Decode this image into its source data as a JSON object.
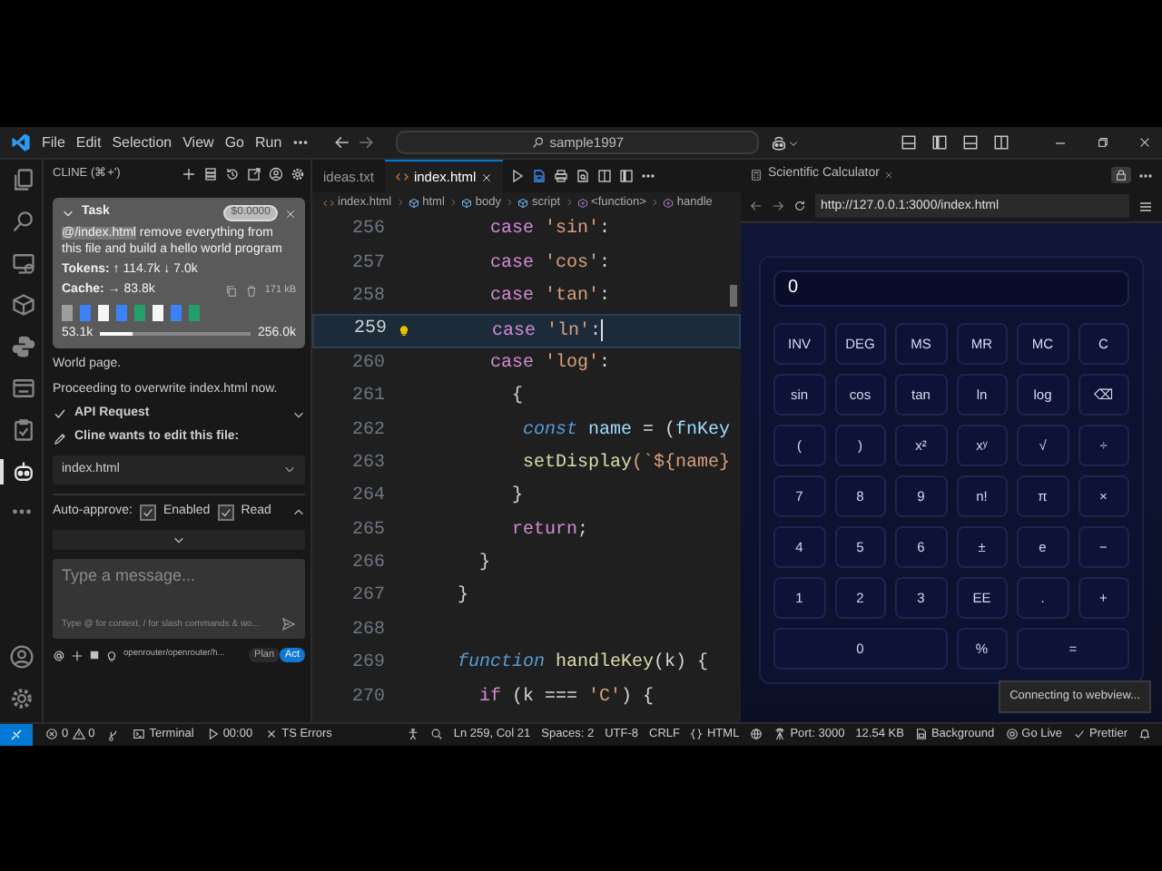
{
  "title_bar": {
    "menu": [
      "File",
      "Edit",
      "Selection",
      "View",
      "Go",
      "Run"
    ],
    "search": "sample1997"
  },
  "activity_bar": {
    "items": [
      {
        "kind": "files",
        "selected": false
      },
      {
        "kind": "search",
        "selected": false
      },
      {
        "kind": "remote",
        "selected": false
      },
      {
        "kind": "extensions",
        "selected": false
      },
      {
        "kind": "python",
        "selected": false
      },
      {
        "kind": "panel",
        "selected": false
      },
      {
        "kind": "tasks",
        "selected": false
      },
      {
        "kind": "robot",
        "selected": true
      }
    ]
  },
  "cline": {
    "header": "CLINE (⌘+')",
    "task": {
      "title": "Task",
      "expanded": true,
      "cost": "$0.0000",
      "mention": "@/index.html",
      "text": "remove everything from this file and build a hello world program",
      "tokens": "**Tokens:** ↑ 114.7k ↓ 7.0k",
      "cache": "**Cache:** → 83.8k",
      "size": "171 kB",
      "segments": [
        {
          "color": "#9e9e9e"
        },
        {
          "color": "#3b82f6"
        },
        {
          "color": "#f5f5f5"
        },
        {
          "color": "#3b82f6"
        },
        {
          "color": "#22a06b"
        },
        {
          "color": "#f5f5f5"
        },
        {
          "color": "#3b82f6"
        },
        {
          "color": "#22a06b"
        }
      ],
      "context": {
        "used": "53.1k",
        "level": 0.22,
        "max": "256.0k"
      }
    },
    "messages": [
      "World page.",
      "Proceeding to overwrite index.html now."
    ],
    "api_request": {
      "title": "API Request",
      "done": true,
      "expanded": false
    },
    "edit_request": {
      "title": "Cline wants to edit this file:",
      "file": "index.html"
    },
    "auto_approve": {
      "label": "Auto-approve:",
      "options": [
        {
          "label": "Enabled",
          "checked": true
        },
        {
          "label": "Read",
          "checked": true
        }
      ]
    },
    "input": {
      "placeholder": "Type a message...",
      "hint": "Type @ for context, / for slash commands & wo..."
    },
    "model": "openrouter/openrouter/h...",
    "modes": [
      {
        "label": "Plan",
        "selected": false
      },
      {
        "label": "Act",
        "selected": true
      }
    ]
  },
  "editor": {
    "tabs": [
      {
        "label": "ideas.txt",
        "selected": false
      },
      {
        "label": "index.html",
        "selected": true
      }
    ],
    "breadcrumb": [
      {
        "label": "index.html",
        "kind": "file"
      },
      {
        "label": "html",
        "kind": "element"
      },
      {
        "label": "body",
        "kind": "element"
      },
      {
        "label": "script",
        "kind": "element"
      },
      {
        "label": "<function>",
        "kind": "function"
      },
      {
        "label": "handle",
        "kind": "function"
      }
    ],
    "lines": [
      {
        "number": "256",
        "current": false,
        "tokens": [
          {
            "text": "       case",
            "kind": "keyword"
          },
          {
            "text": " 'sin'",
            "kind": "string"
          },
          {
            "text": ":",
            "kind": "plain"
          }
        ]
      },
      {
        "number": "257",
        "current": false,
        "tokens": [
          {
            "text": "       case",
            "kind": "keyword"
          },
          {
            "text": " 'cos'",
            "kind": "string"
          },
          {
            "text": ":",
            "kind": "plain"
          }
        ]
      },
      {
        "number": "258",
        "current": false,
        "tokens": [
          {
            "text": "       case",
            "kind": "keyword"
          },
          {
            "text": " 'tan'",
            "kind": "string"
          },
          {
            "text": ":",
            "kind": "plain"
          }
        ]
      },
      {
        "number": "259",
        "current": true,
        "tokens": [
          {
            "text": "       case",
            "kind": "keyword"
          },
          {
            "text": " 'ln'",
            "kind": "string"
          },
          {
            "text": ":",
            "kind": "plain"
          }
        ]
      },
      {
        "number": "260",
        "current": false,
        "tokens": [
          {
            "text": "       case",
            "kind": "keyword"
          },
          {
            "text": " 'log'",
            "kind": "string"
          },
          {
            "text": ":",
            "kind": "plain"
          }
        ]
      },
      {
        "number": "261",
        "current": false,
        "tokens": [
          {
            "text": "         {",
            "kind": "plain"
          }
        ]
      },
      {
        "number": "262",
        "current": false,
        "tokens": [
          {
            "text": "          const",
            "kind": "declare"
          },
          {
            "text": " name",
            "kind": "variable"
          },
          {
            "text": " = (",
            "kind": "plain"
          },
          {
            "text": "fnKey",
            "kind": "variable"
          }
        ]
      },
      {
        "number": "263",
        "current": false,
        "tokens": [
          {
            "text": "          setDisplay",
            "kind": "function"
          },
          {
            "text": "(`${name}",
            "kind": "string"
          }
        ]
      },
      {
        "number": "264",
        "current": false,
        "tokens": [
          {
            "text": "         }",
            "kind": "plain"
          }
        ]
      },
      {
        "number": "265",
        "current": false,
        "tokens": [
          {
            "text": "         return",
            "kind": "keyword"
          },
          {
            "text": ";",
            "kind": "plain"
          }
        ]
      },
      {
        "number": "266",
        "current": false,
        "tokens": [
          {
            "text": "      }",
            "kind": "plain"
          }
        ]
      },
      {
        "number": "267",
        "current": false,
        "tokens": [
          {
            "text": "    }",
            "kind": "plain"
          }
        ]
      },
      {
        "number": "268",
        "current": false
      },
      {
        "number": "269",
        "current": false,
        "tokens": [
          {
            "text": "    function",
            "kind": "declare"
          },
          {
            "text": " handleKey",
            "kind": "function"
          },
          {
            "text": "(k) {",
            "kind": "plain"
          }
        ]
      },
      {
        "number": "270",
        "current": false,
        "tokens": [
          {
            "text": "      if",
            "kind": "keyword"
          },
          {
            "text": " (k === ",
            "kind": "plain"
          },
          {
            "text": "'C'",
            "kind": "string"
          },
          {
            "text": ") {",
            "kind": "plain"
          }
        ]
      }
    ]
  },
  "browser": {
    "tab": "Scientific Calculator",
    "url": "http://127.0.0.1:3000/index.html",
    "calculator": {
      "display": "0",
      "keys": [
        {
          "label": "INV",
          "kind": "single"
        },
        {
          "label": "DEG",
          "kind": "single"
        },
        {
          "label": "MS",
          "kind": "single"
        },
        {
          "label": "MR",
          "kind": "single"
        },
        {
          "label": "MC",
          "kind": "single"
        },
        {
          "label": "C",
          "kind": "single"
        },
        {
          "label": "sin",
          "kind": "single"
        },
        {
          "label": "cos",
          "kind": "single"
        },
        {
          "label": "tan",
          "kind": "single"
        },
        {
          "label": "ln",
          "kind": "single"
        },
        {
          "label": "log",
          "kind": "single"
        },
        {
          "label": "⌫",
          "kind": "single"
        },
        {
          "label": "(",
          "kind": "single"
        },
        {
          "label": ")",
          "kind": "single"
        },
        {
          "label": "x²",
          "kind": "single"
        },
        {
          "label": "xʸ",
          "kind": "single"
        },
        {
          "label": "√",
          "kind": "single"
        },
        {
          "label": "÷",
          "kind": "single"
        },
        {
          "label": "7",
          "kind": "single"
        },
        {
          "label": "8",
          "kind": "single"
        },
        {
          "label": "9",
          "kind": "single"
        },
        {
          "label": "n!",
          "kind": "single"
        },
        {
          "label": "π",
          "kind": "single"
        },
        {
          "label": "×",
          "kind": "single"
        },
        {
          "label": "4",
          "kind": "single"
        },
        {
          "label": "5",
          "kind": "single"
        },
        {
          "label": "6",
          "kind": "single"
        },
        {
          "label": "±",
          "kind": "single"
        },
        {
          "label": "e",
          "kind": "single"
        },
        {
          "label": "−",
          "kind": "single"
        },
        {
          "label": "1",
          "kind": "single"
        },
        {
          "label": "2",
          "kind": "single"
        },
        {
          "label": "3",
          "kind": "single"
        },
        {
          "label": "EE",
          "kind": "single"
        },
        {
          "label": ".",
          "kind": "single"
        },
        {
          "label": "+",
          "kind": "single"
        },
        {
          "label": "0",
          "kind": "triple"
        },
        {
          "label": "%",
          "kind": "single"
        },
        {
          "label": "=",
          "kind": "double"
        }
      ]
    },
    "tooltip": "Connecting to webview..."
  },
  "status_bar": {
    "left": [
      {
        "kind": "problems",
        "errors": "0",
        "warnings": "0"
      },
      {
        "kind": "terminal",
        "text": "Terminal"
      },
      {
        "kind": "play",
        "text": "00:00"
      },
      {
        "kind": "cross",
        "text": "TS Errors"
      }
    ],
    "right": [
      {
        "kind": "plain",
        "text": "Ln 259, Col 21"
      },
      {
        "kind": "plain",
        "text": "Spaces: 2"
      },
      {
        "kind": "plain",
        "text": "UTF-8"
      },
      {
        "kind": "plain",
        "text": "CRLF"
      },
      {
        "kind": "braces",
        "text": "HTML"
      },
      {
        "kind": "antenna",
        "text": "Port: 3000"
      },
      {
        "kind": "plain",
        "text": "12.54 KB"
      },
      {
        "kind": "file",
        "text": "Background"
      },
      {
        "kind": "broadcast",
        "text": "Go Live"
      },
      {
        "kind": "check",
        "text": "Prettier"
      }
    ]
  }
}
